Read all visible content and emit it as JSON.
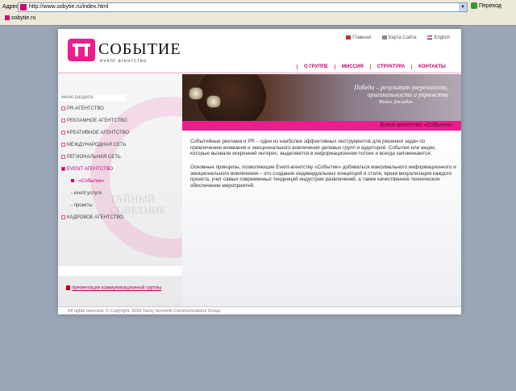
{
  "browser": {
    "address_label": "Адрес:",
    "address_value": "http://www.sobytie.ru/index.html",
    "go_label": "Переход",
    "tab_label": "sobytie.ru"
  },
  "header": {
    "logo_title": "СОБЫТИЕ",
    "logo_subtitle": "event агентство",
    "top_links": [
      "Главная",
      "Карта Сайта",
      "English"
    ],
    "nav": [
      "О ГРУППЕ",
      "МИССИЯ",
      "СТРУКТУРА",
      "КОНТАКТЫ"
    ]
  },
  "sidebar": {
    "title": "меню раздела",
    "items": [
      {
        "label": "PR-АГЕНТСТВО"
      },
      {
        "label": "РЕКЛАМНОЕ АГЕНТСТВО"
      },
      {
        "label": "КРЕАТИВНОЕ АГЕНТСТВО"
      },
      {
        "label": "МЕЖДУНАРОДНАЯ СЕТЬ"
      },
      {
        "label": "РЕГИОНАЛЬНАЯ СЕТЬ"
      },
      {
        "label": "EVENT АГЕНТСТВО"
      }
    ],
    "subitems": [
      "- «Событие»",
      "- event услуги",
      "- проекты"
    ],
    "last_item": "КАДРОВОЕ АГЕНТСТВО",
    "watermark": "ТАЙНЫЙ СОВЕТНИК",
    "presentation_link": "презентация коммуникационной группы"
  },
  "banner": {
    "quote": "Победа – результат уверенности, оригинальности и упрямства",
    "author": "Майкл Джордан",
    "strip_text": "Event-агентство «Событие»"
  },
  "content": {
    "paragraph1": "Событийные реклама и PR – одни из наиболее эффективных инструментов для решения задач по привлечению внимания и эмоционального вовлечения целевых групп и аудиторий. События или акции, которые вызвали искренний интерес, выделяются в информационном потоке и всегда запоминаются.",
    "paragraph2": "Основные принципы, позволяющие Event-агентству «Событие» добиваться максимального информационного и эмоционального вовлечения – это создание индивидуальных концепций и стиля, яркая визуализация каждого проекта, учет самых современных тенденций индустрии развлечений, а также качественное техническое обеспечение мероприятий."
  },
  "footer": {
    "text": "All rights reserved. © Copyright, 2009 Tainiy Sovetnik Communications Group."
  },
  "colors": {
    "brand_pink": "#ec1d8c",
    "link_magenta": "#c4006a"
  }
}
